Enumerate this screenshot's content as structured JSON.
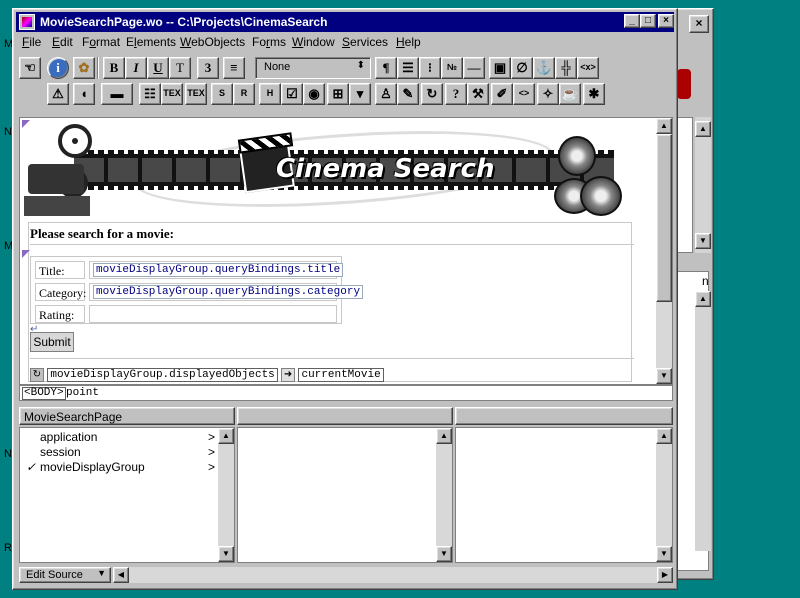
{
  "window": {
    "title": "MovieSearchPage.wo  --  C:\\Projects\\CinemaSearch",
    "minimize_glyph": "_",
    "maximize_glyph": "□",
    "close_glyph": "×"
  },
  "menus": [
    {
      "prefix": "",
      "accel": "F",
      "rest": "ile"
    },
    {
      "prefix": "",
      "accel": "E",
      "rest": "dit"
    },
    {
      "prefix": "F",
      "accel": "o",
      "rest": "rmat"
    },
    {
      "prefix": "E",
      "accel": "l",
      "rest": "ements"
    },
    {
      "prefix": "",
      "accel": "W",
      "rest": "ebObjects"
    },
    {
      "prefix": "Fo",
      "accel": "r",
      "rest": "ms"
    },
    {
      "prefix": "",
      "accel": "W",
      "rest": "indow"
    },
    {
      "prefix": "",
      "accel": "S",
      "rest": "ervices"
    },
    {
      "prefix": "",
      "accel": "H",
      "rest": "elp"
    }
  ],
  "toolbar": {
    "row1": [
      {
        "name": "inspector-icon",
        "glyph": "☜"
      },
      {
        "name": "info-icon",
        "glyph": "i"
      },
      {
        "name": "palette-icon",
        "glyph": "✿"
      },
      {
        "name": "bold-button",
        "glyph": "B"
      },
      {
        "name": "italic-button",
        "glyph": "I"
      },
      {
        "name": "underline-button",
        "glyph": "U"
      },
      {
        "name": "typewriter-button",
        "glyph": "T"
      },
      {
        "name": "font-size-button",
        "glyph": "3"
      },
      {
        "name": "align-icon",
        "glyph": "≡"
      }
    ],
    "paragraph_style": "None",
    "row1_right": [
      {
        "name": "paragraph-icon",
        "glyph": "¶"
      },
      {
        "name": "lines-icon",
        "glyph": "☰"
      },
      {
        "name": "bullet-list-icon",
        "glyph": "⁝"
      },
      {
        "name": "numbered-list-icon",
        "glyph": "№"
      },
      {
        "name": "horizontal-rule-icon",
        "glyph": "—"
      },
      {
        "name": "image-icon",
        "glyph": "▣"
      },
      {
        "name": "link-icon",
        "glyph": "∅"
      },
      {
        "name": "anchor-icon",
        "glyph": "⚓"
      },
      {
        "name": "table-icon",
        "glyph": "╬"
      },
      {
        "name": "html-tag-icon",
        "glyph": "<x>"
      }
    ],
    "row2": [
      {
        "name": "warning-icon",
        "glyph": "⚠"
      },
      {
        "name": "form-icon",
        "glyph": "◖"
      },
      {
        "name": "text-field-icon",
        "glyph": "▬"
      },
      {
        "name": "browser-list-icon",
        "glyph": "☷"
      },
      {
        "name": "text-icon",
        "glyph": "TEX"
      },
      {
        "name": "text-area-icon",
        "glyph": "TEX"
      },
      {
        "name": "string-icon",
        "glyph": "S"
      },
      {
        "name": "reset-icon",
        "glyph": "R"
      },
      {
        "name": "hidden-icon",
        "glyph": "H"
      },
      {
        "name": "checkbox-icon",
        "glyph": "☑"
      },
      {
        "name": "radio-icon",
        "glyph": "◉"
      },
      {
        "name": "image-button-icon",
        "glyph": "⊞"
      },
      {
        "name": "popup-icon",
        "glyph": "▾"
      }
    ],
    "row2_right": [
      {
        "name": "person-icon",
        "glyph": "♙"
      },
      {
        "name": "pencil-icon",
        "glyph": "✎"
      },
      {
        "name": "refresh-icon",
        "glyph": "↻"
      },
      {
        "name": "help-icon",
        "glyph": "?"
      },
      {
        "name": "wrench-icon",
        "glyph": "⚒"
      },
      {
        "name": "edit-image-icon",
        "glyph": "✐"
      },
      {
        "name": "code-icon",
        "glyph": "<>"
      },
      {
        "name": "magic-icon",
        "glyph": "✧"
      },
      {
        "name": "coffee-icon",
        "glyph": "☕"
      },
      {
        "name": "star-icon",
        "glyph": "✱"
      }
    ]
  },
  "document": {
    "banner_title": "Cinema Search",
    "search_heading": "Please search for a movie:",
    "form": {
      "rows": [
        {
          "label": "Title:",
          "binding": "movieDisplayGroup.queryBindings.title"
        },
        {
          "label": "Category:",
          "binding": "movieDisplayGroup.queryBindings.category"
        },
        {
          "label": "Rating:",
          "binding": ""
        }
      ],
      "submit_label": "Submit"
    },
    "repetition": {
      "list_binding": "movieDisplayGroup.displayedObjects",
      "item_binding": "currentMovie"
    }
  },
  "pathbar": {
    "tag": "<BODY>",
    "current": "point"
  },
  "browser": {
    "pane1_title": "MovieSearchPage",
    "items": [
      {
        "label": "application",
        "checked": "",
        "chevron": ">"
      },
      {
        "label": "session",
        "checked": "",
        "chevron": ">"
      },
      {
        "label": "movieDisplayGroup",
        "checked": "✓",
        "chevron": ">"
      }
    ]
  },
  "status": {
    "mode": "Edit Source"
  },
  "background_window": {
    "partial_text": "n"
  },
  "desktop_letters": [
    "M",
    "N",
    "M",
    "N",
    "R"
  ]
}
